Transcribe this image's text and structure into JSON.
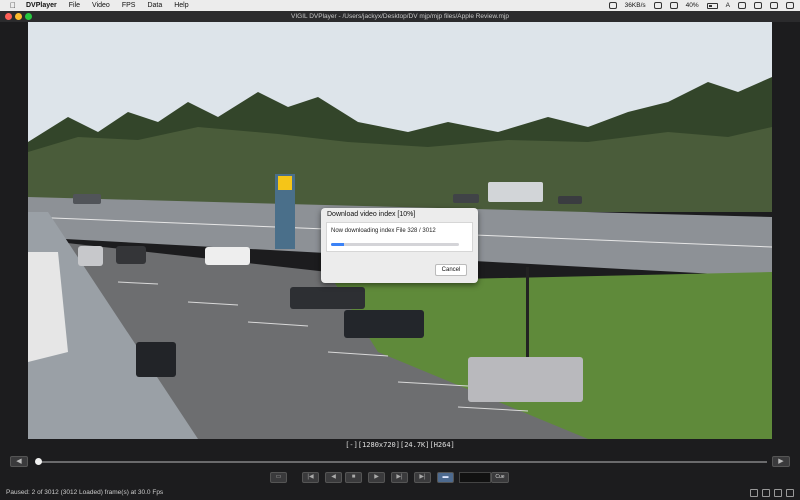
{
  "menubar": {
    "app_name": "DVPlayer",
    "items": [
      "File",
      "Video",
      "FPS",
      "Data",
      "Help"
    ],
    "status": {
      "net": "36KB/s",
      "battery": "40%",
      "keyboard": "A"
    }
  },
  "window": {
    "title": "VIGIL DVPlayer - /Users/jackyx/Desktop/DV mjp/mjp files/Apple Review.mjp"
  },
  "video_info": "[-][1280x720][24.7K][H264]",
  "dialog": {
    "title": "Download video index [10%]",
    "message": "Now downloading index File 328 / 3012",
    "progress": 0.1,
    "cancel_label": "Cancel"
  },
  "seek": {
    "position": 0.002,
    "prev_icon": "step-back-icon",
    "next_icon": "step-forward-icon"
  },
  "controls": {
    "buttons": [
      {
        "name": "folder-icon",
        "glyph": "▭"
      },
      {
        "name": "skip-start-icon",
        "glyph": "|◀"
      },
      {
        "name": "step-back-icon",
        "glyph": "◀"
      },
      {
        "name": "stop-icon",
        "glyph": "■"
      },
      {
        "name": "play-icon",
        "glyph": "▶"
      },
      {
        "name": "step-forward-icon",
        "glyph": "▶|"
      },
      {
        "name": "skip-end-icon",
        "glyph": "▶|"
      },
      {
        "name": "overlay-icon",
        "glyph": "▬"
      }
    ],
    "frame_value": "",
    "go_label": "Cue"
  },
  "status": {
    "text": "Paused: 2 of 3012 (3012 Loaded) frame(s) at 30.0 Fps"
  },
  "colors": {
    "accent": "#3b82f6",
    "window_bg": "#1c1c1e"
  }
}
